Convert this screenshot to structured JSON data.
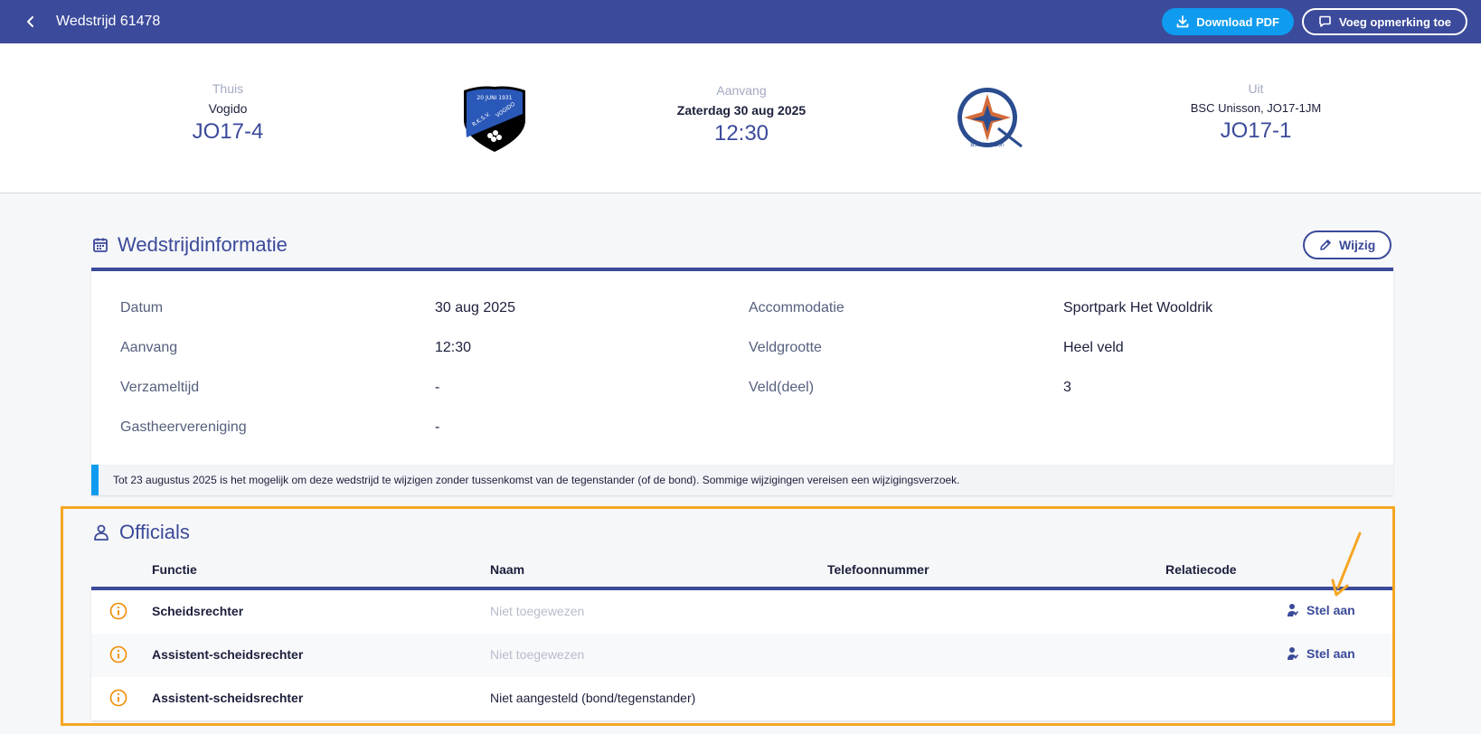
{
  "topbar": {
    "title": "Wedstrijd 61478",
    "download_label": "Download PDF",
    "comment_label": "Voeg opmerking toe"
  },
  "match": {
    "home": {
      "label": "Thuis",
      "club": "Vogido",
      "team": "JO17-4"
    },
    "kickoff": {
      "label": "Aanvang",
      "date": "Zaterdag 30 aug 2025",
      "time": "12:30"
    },
    "away": {
      "label": "Uit",
      "club": "BSC Unisson, JO17-1JM",
      "team": "JO17-1"
    },
    "home_logo": {
      "top_text": "20 JUNI 1931",
      "left_text": "R.K.S.V.",
      "right_text": "VOGIDO"
    },
    "away_logo": {
      "text": "BSC Unisson"
    }
  },
  "info": {
    "title": "Wedstrijdinformatie",
    "edit_label": "Wijzig",
    "fields": [
      {
        "label": "Datum",
        "value": "30 aug 2025"
      },
      {
        "label": "Aanvang",
        "value": "12:30"
      },
      {
        "label": "Verzameltijd",
        "value": "-"
      },
      {
        "label": "Gastheervereniging",
        "value": "-"
      },
      {
        "label": "Accommodatie",
        "value": "Sportpark Het Wooldrik"
      },
      {
        "label": "Veldgrootte",
        "value": "Heel veld"
      },
      {
        "label": "Veld(deel)",
        "value": "3"
      }
    ],
    "notice": "Tot 23 augustus 2025 is het mogelijk om deze wedstrijd te wijzigen zonder tussenkomst van de tegenstander (of de bond). Sommige wijzigingen vereisen een wijzigingsverzoek."
  },
  "officials": {
    "title": "Officials",
    "columns": [
      "Functie",
      "Naam",
      "Telefoonnummer",
      "Relatiecode"
    ],
    "rows": [
      {
        "function": "Scheidsrechter",
        "name": "Niet toegewezen",
        "action": "Stel aan"
      },
      {
        "function": "Assistent-scheidsrechter",
        "name": "Niet toegewezen",
        "action": "Stel aan"
      },
      {
        "function": "Assistent-scheidsrechter",
        "name": "Niet aangesteld (bond/tegenstander)"
      }
    ]
  },
  "colors": {
    "primary": "#3b4a9a",
    "accent": "#0f9bef",
    "highlight": "#f5a623",
    "warning": "#f08c00"
  }
}
